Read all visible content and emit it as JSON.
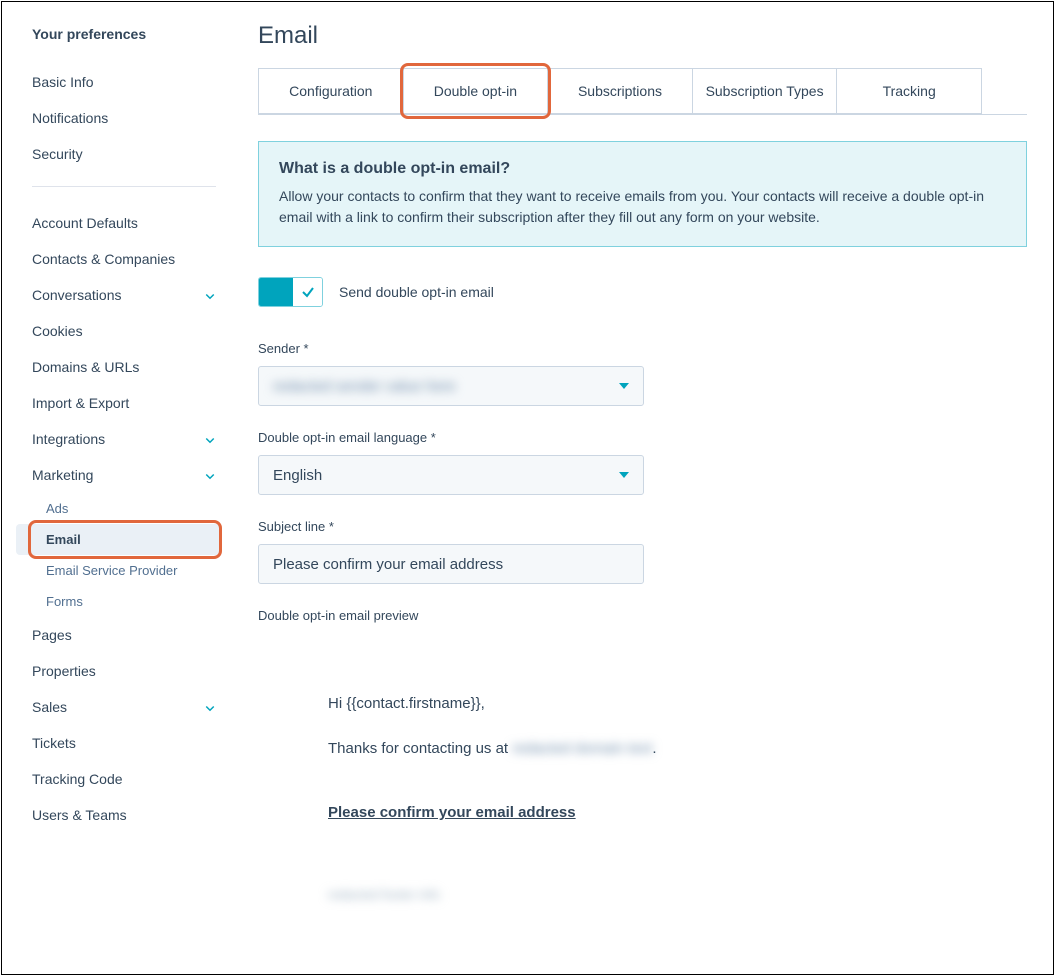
{
  "sidebar": {
    "heading": "Your preferences",
    "group1": [
      {
        "label": "Basic Info"
      },
      {
        "label": "Notifications"
      },
      {
        "label": "Security"
      }
    ],
    "group2": [
      {
        "label": "Account Defaults"
      },
      {
        "label": "Contacts & Companies"
      },
      {
        "label": "Conversations",
        "expandable": true
      },
      {
        "label": "Cookies"
      },
      {
        "label": "Domains & URLs"
      },
      {
        "label": "Import & Export"
      },
      {
        "label": "Integrations",
        "expandable": true
      },
      {
        "label": "Marketing",
        "expandable": true
      }
    ],
    "marketing_children": [
      {
        "label": "Ads"
      },
      {
        "label": "Email",
        "active": true
      },
      {
        "label": "Email Service Provider"
      },
      {
        "label": "Forms"
      }
    ],
    "group3": [
      {
        "label": "Pages"
      },
      {
        "label": "Properties"
      },
      {
        "label": "Sales",
        "expandable": true
      },
      {
        "label": "Tickets"
      },
      {
        "label": "Tracking Code"
      },
      {
        "label": "Users & Teams"
      }
    ]
  },
  "main": {
    "title": "Email",
    "tabs": [
      "Configuration",
      "Double opt-in",
      "Subscriptions",
      "Subscription Types",
      "Tracking"
    ],
    "active_tab_index": 1,
    "callout": {
      "title": "What is a double opt-in email?",
      "body": "Allow your contacts to confirm that they want to receive emails from you. Your contacts will receive a double opt-in email with a link to confirm their subscription after they fill out any form on your website."
    },
    "toggle_label": "Send double opt-in email",
    "toggle_on": true,
    "fields": {
      "sender_label": "Sender *",
      "sender_value": "redacted sender value here",
      "language_label": "Double opt-in email language  *",
      "language_value": "English",
      "subject_label": "Subject line *",
      "subject_value": "Please confirm your email address",
      "preview_label": "Double opt-in email preview"
    },
    "preview": {
      "greeting": "Hi {{contact.firstname}},",
      "thanks_prefix": "Thanks for contacting us at ",
      "thanks_blur": "redacted domain text",
      "thanks_suffix": ".",
      "confirm_text": "Please confirm your email address",
      "footer_blur": "redacted footer info"
    }
  }
}
